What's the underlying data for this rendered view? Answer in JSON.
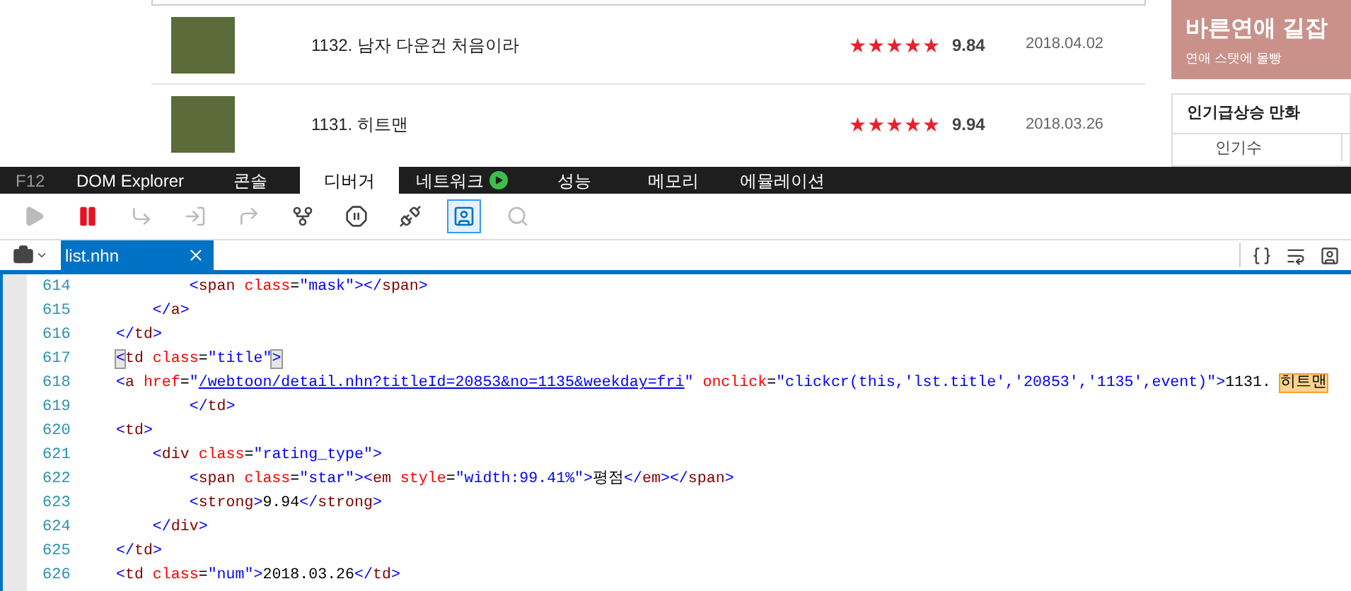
{
  "webpage": {
    "rows": [
      {
        "title": "1132. 남자 다운건 처음이라",
        "stars": 5,
        "score": "9.84",
        "date": "2018.04.02"
      },
      {
        "title": "1131. 히트맨",
        "stars": 5,
        "score": "9.94",
        "date": "2018.03.26"
      }
    ],
    "banner": {
      "title": "바른연애 길잡",
      "subtitle": "연애 스탯에 몰빵"
    },
    "ranking": {
      "title": "인기급상승 만화",
      "tab": "인기수"
    }
  },
  "devtools": {
    "f12_label": "F12",
    "tabs": [
      {
        "label": "DOM Explorer",
        "selected": false
      },
      {
        "label": "콘솔",
        "selected": false
      },
      {
        "label": "디버거",
        "selected": true
      },
      {
        "label": "네트워크",
        "selected": false,
        "recording": true
      },
      {
        "label": "성능",
        "selected": false
      },
      {
        "label": "메모리",
        "selected": false
      },
      {
        "label": "에뮬레이션",
        "selected": false
      }
    ],
    "toolbar": [
      {
        "kind": "play",
        "disabled": true
      },
      {
        "kind": "pause",
        "disabled": false
      },
      {
        "kind": "step-into",
        "disabled": true
      },
      {
        "kind": "step-over",
        "disabled": true
      },
      {
        "kind": "step-out",
        "disabled": true
      },
      {
        "kind": "break-new-worker",
        "disabled": false
      },
      {
        "kind": "exceptions",
        "disabled": false
      },
      {
        "kind": "disconnect",
        "disabled": false
      },
      {
        "kind": "just-my-code",
        "disabled": false,
        "selected": true
      },
      {
        "kind": "find",
        "disabled": true
      }
    ],
    "file_tab": {
      "label": "list.nhn",
      "selected": true
    },
    "code": [
      {
        "number": "614",
        "tokens": [
          {
            "kind": "punct",
            "text": "        <"
          },
          {
            "kind": "tag",
            "text": "span"
          },
          {
            "kind": "attr",
            "text": " class"
          },
          {
            "kind": "eq",
            "text": "="
          },
          {
            "kind": "value",
            "text": "\"mask\""
          },
          {
            "kind": "punct",
            "text": "></"
          },
          {
            "kind": "tag",
            "text": "span"
          },
          {
            "kind": "punct",
            "text": ">"
          }
        ]
      },
      {
        "number": "615",
        "tokens": [
          {
            "kind": "punct",
            "text": "    </"
          },
          {
            "kind": "tag",
            "text": "a"
          },
          {
            "kind": "punct",
            "text": ">"
          }
        ]
      },
      {
        "number": "616",
        "tokens": [
          {
            "kind": "punct",
            "text": "</"
          },
          {
            "kind": "tag",
            "text": "td"
          },
          {
            "kind": "punct",
            "text": ">"
          }
        ]
      },
      {
        "number": "617",
        "tokens": [
          {
            "kind": "match",
            "text": "<"
          },
          {
            "kind": "tag",
            "text": "td"
          },
          {
            "kind": "attr",
            "text": " class"
          },
          {
            "kind": "eq",
            "text": "="
          },
          {
            "kind": "value",
            "text": "\"title\""
          },
          {
            "kind": "match",
            "text": ">"
          }
        ]
      },
      {
        "number": "618",
        "tokens": [
          {
            "kind": "punct",
            "text": "<"
          },
          {
            "kind": "tag",
            "text": "a"
          },
          {
            "kind": "attr",
            "text": " href"
          },
          {
            "kind": "eq",
            "text": "="
          },
          {
            "kind": "value",
            "text": "\""
          },
          {
            "kind": "link",
            "text": "/webtoon/detail.nhn?titleId=20853&no=1135&weekday=fri"
          },
          {
            "kind": "value",
            "text": "\""
          },
          {
            "kind": "attr",
            "text": " onclick"
          },
          {
            "kind": "eq",
            "text": "="
          },
          {
            "kind": "value",
            "text": "\"clickcr(this,'lst.title','20853','1135',event)\""
          },
          {
            "kind": "punct",
            "text": ">"
          },
          {
            "kind": "text",
            "text": "1131. "
          },
          {
            "kind": "highlight",
            "text": "히트맨"
          }
        ]
      },
      {
        "number": "619",
        "tokens": [
          {
            "kind": "punct",
            "text": "        </"
          },
          {
            "kind": "tag",
            "text": "td"
          },
          {
            "kind": "punct",
            "text": ">"
          }
        ]
      },
      {
        "number": "620",
        "tokens": [
          {
            "kind": "punct",
            "text": "<"
          },
          {
            "kind": "tag",
            "text": "td"
          },
          {
            "kind": "punct",
            "text": ">"
          }
        ]
      },
      {
        "number": "621",
        "tokens": [
          {
            "kind": "punct",
            "text": "    <"
          },
          {
            "kind": "tag",
            "text": "div"
          },
          {
            "kind": "attr",
            "text": " class"
          },
          {
            "kind": "eq",
            "text": "="
          },
          {
            "kind": "value",
            "text": "\"rating_type\""
          },
          {
            "kind": "punct",
            "text": ">"
          }
        ]
      },
      {
        "number": "622",
        "tokens": [
          {
            "kind": "punct",
            "text": "        <"
          },
          {
            "kind": "tag",
            "text": "span"
          },
          {
            "kind": "attr",
            "text": " class"
          },
          {
            "kind": "eq",
            "text": "="
          },
          {
            "kind": "value",
            "text": "\"star\""
          },
          {
            "kind": "punct",
            "text": "><"
          },
          {
            "kind": "tag",
            "text": "em"
          },
          {
            "kind": "attr",
            "text": " style"
          },
          {
            "kind": "eq",
            "text": "="
          },
          {
            "kind": "value",
            "text": "\"width:99.41%\""
          },
          {
            "kind": "punct",
            "text": ">"
          },
          {
            "kind": "text",
            "text": "평점"
          },
          {
            "kind": "punct",
            "text": "</"
          },
          {
            "kind": "tag",
            "text": "em"
          },
          {
            "kind": "punct",
            "text": "></"
          },
          {
            "kind": "tag",
            "text": "span"
          },
          {
            "kind": "punct",
            "text": ">"
          }
        ]
      },
      {
        "number": "623",
        "tokens": [
          {
            "kind": "punct",
            "text": "        <"
          },
          {
            "kind": "tag",
            "text": "strong"
          },
          {
            "kind": "punct",
            "text": ">"
          },
          {
            "kind": "text",
            "text": "9.94"
          },
          {
            "kind": "punct",
            "text": "</"
          },
          {
            "kind": "tag",
            "text": "strong"
          },
          {
            "kind": "punct",
            "text": ">"
          }
        ]
      },
      {
        "number": "624",
        "tokens": [
          {
            "kind": "punct",
            "text": "    </"
          },
          {
            "kind": "tag",
            "text": "div"
          },
          {
            "kind": "punct",
            "text": ">"
          }
        ]
      },
      {
        "number": "625",
        "tokens": [
          {
            "kind": "punct",
            "text": "</"
          },
          {
            "kind": "tag",
            "text": "td"
          },
          {
            "kind": "punct",
            "text": ">"
          }
        ]
      },
      {
        "number": "626",
        "tokens": [
          {
            "kind": "punct",
            "text": "<"
          },
          {
            "kind": "tag",
            "text": "td"
          },
          {
            "kind": "attr",
            "text": " class"
          },
          {
            "kind": "eq",
            "text": "="
          },
          {
            "kind": "value",
            "text": "\"num\""
          },
          {
            "kind": "punct",
            "text": ">"
          },
          {
            "kind": "text",
            "text": "2018.03.26"
          },
          {
            "kind": "punct",
            "text": "</"
          },
          {
            "kind": "tag",
            "text": "td"
          },
          {
            "kind": "punct",
            "text": ">"
          }
        ]
      }
    ]
  }
}
